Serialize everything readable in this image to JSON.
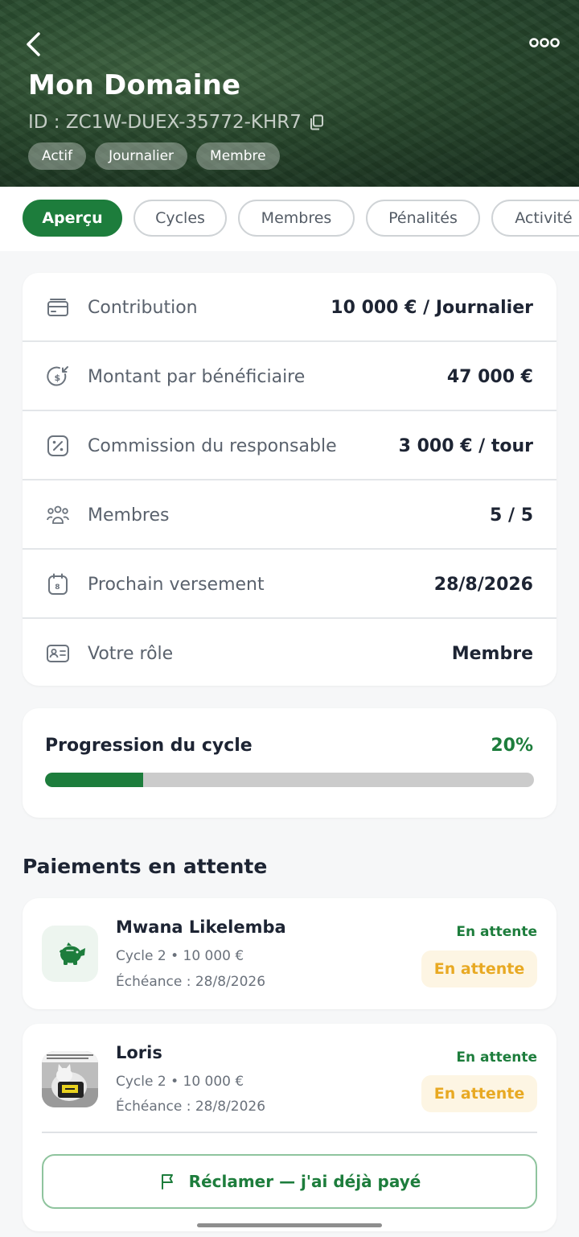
{
  "header": {
    "title": "Mon Domaine",
    "id_text": "ID : ZC1W-DUEX-35772-KHR7",
    "chips": [
      "Actif",
      "Journalier",
      "Membre"
    ]
  },
  "tabs": [
    {
      "label": "Aperçu",
      "active": true
    },
    {
      "label": "Cycles",
      "active": false
    },
    {
      "label": "Membres",
      "active": false
    },
    {
      "label": "Pénalités",
      "active": false
    },
    {
      "label": "Activité",
      "active": false
    }
  ],
  "details": [
    {
      "icon": "card-icon",
      "label": "Contribution",
      "value": "10 000 € / Journalier"
    },
    {
      "icon": "dollar-refund-icon",
      "label": "Montant par bénéficiaire",
      "value": "47 000 €"
    },
    {
      "icon": "percent-icon",
      "label": "Commission du responsable",
      "value": "3 000 € / tour"
    },
    {
      "icon": "users-icon",
      "label": "Membres",
      "value": "5 / 5"
    },
    {
      "icon": "calendar-icon",
      "label": "Prochain versement",
      "value": "28/8/2026"
    },
    {
      "icon": "id-card-icon",
      "label": "Votre rôle",
      "value": "Membre"
    }
  ],
  "progress": {
    "title": "Progression du cycle",
    "percent_label": "20%",
    "fraction": 0.2
  },
  "pending": {
    "title": "Paiements en attente",
    "items": [
      {
        "name": "Mwana Likelemba",
        "cycle": "Cycle 2 • 10 000 €",
        "due": "Échéance : 28/8/2026",
        "status": "En attente",
        "badge": "En attente",
        "avatar": "piggy-bank-icon"
      },
      {
        "name": "Loris",
        "cycle": "Cycle 2 • 10 000 €",
        "due": "Échéance : 28/8/2026",
        "status": "En attente",
        "badge": "En attente",
        "avatar": "cat-photo"
      }
    ],
    "claim_label": "Réclamer — j'ai déjà payé"
  },
  "colors": {
    "accent": "#1d7d3c",
    "pending_bg": "#fdf5e3",
    "pending_text": "#e8a923"
  }
}
